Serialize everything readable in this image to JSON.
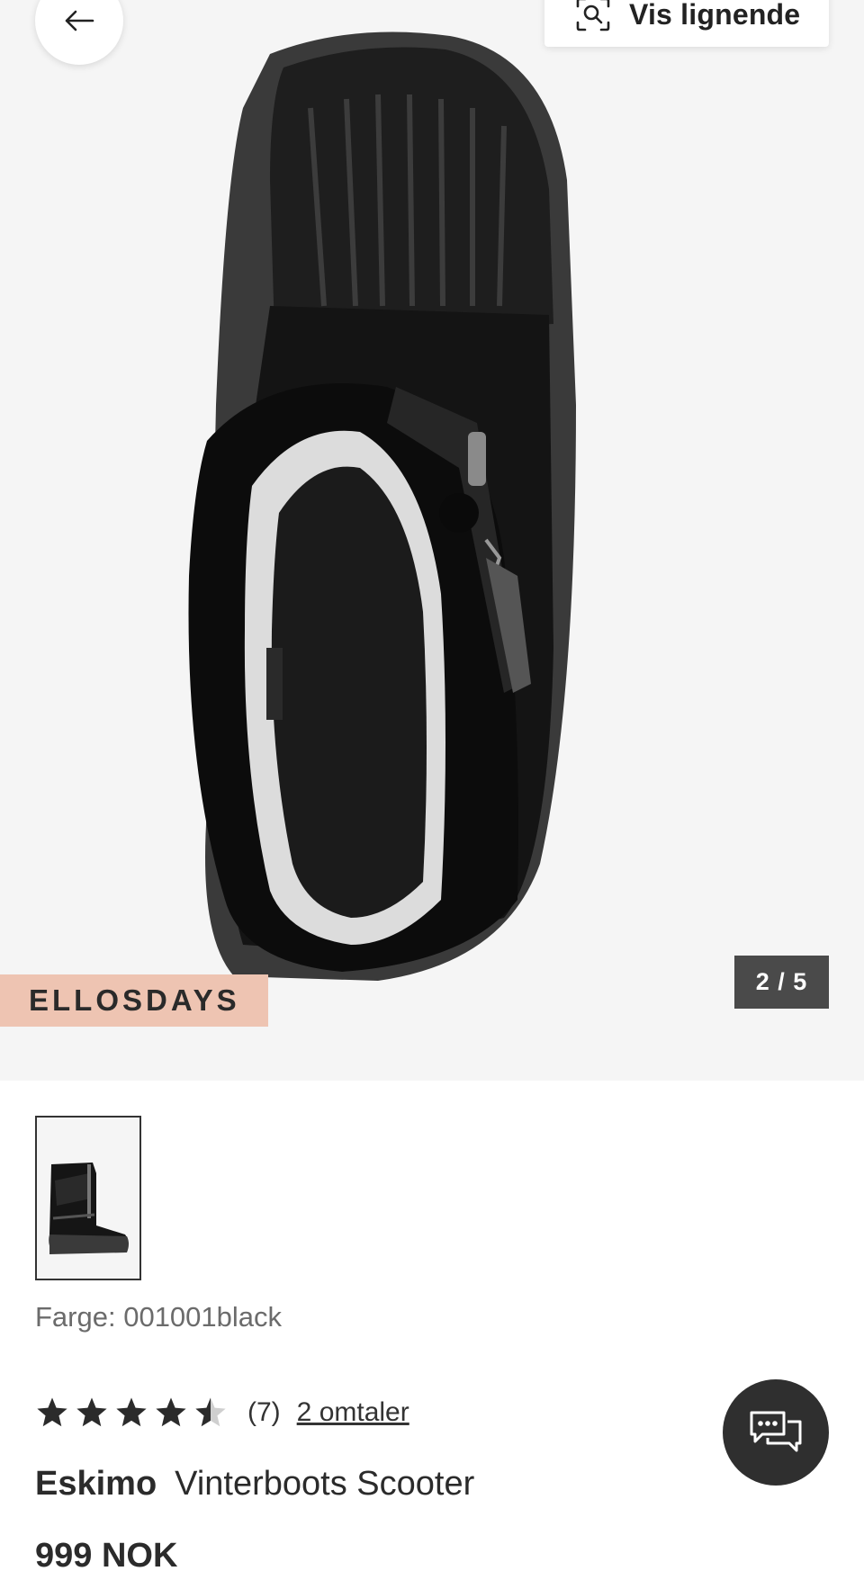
{
  "header": {
    "similar_label": "Vis lignende"
  },
  "gallery": {
    "promo_badge": "ELLOSDAYS",
    "counter": "2 / 5"
  },
  "product": {
    "color_text": "Farge: 001001black",
    "rating_value": 4.5,
    "rating_max": 5,
    "review_count": "(7)",
    "reviews_link": "2 omtaler",
    "brand": "Eskimo",
    "name": "Vinterboots Scooter",
    "price": "999 NOK"
  },
  "icons": {
    "back": "arrow-left-icon",
    "similar": "visual-search-icon",
    "chat": "chat-bubbles-icon",
    "star": "star-icon"
  },
  "colors": {
    "hero_bg": "#f5f5f5",
    "promo_bg": "#eec4b2",
    "counter_bg": "#4a4a4a",
    "chat_bg": "#2f2f2f"
  }
}
